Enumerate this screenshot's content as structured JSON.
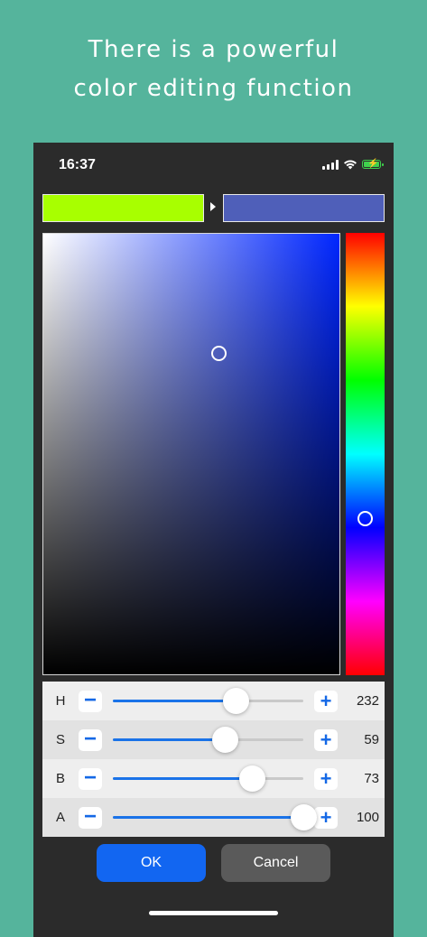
{
  "headline": {
    "line1": "There is a powerful",
    "line2": "color editing function"
  },
  "status_bar": {
    "time": "16:37",
    "icons": [
      "signal-icon",
      "wifi-icon",
      "battery-charging-icon"
    ]
  },
  "colors": {
    "old_color": "#a8ff00",
    "new_color": "#4f5fb9",
    "accent": "#1266f1"
  },
  "picker": {
    "saturation_fraction": 0.59,
    "brightness_fraction": 0.73,
    "hue_degrees": 232
  },
  "sliders": [
    {
      "label": "H",
      "value": "232",
      "fraction": 0.644
    },
    {
      "label": "S",
      "value": "59",
      "fraction": 0.59
    },
    {
      "label": "B",
      "value": "73",
      "fraction": 0.73
    },
    {
      "label": "A",
      "value": "100",
      "fraction": 1.0
    }
  ],
  "buttons": {
    "ok": "OK",
    "cancel": "Cancel",
    "minus": "−",
    "plus": "+"
  }
}
